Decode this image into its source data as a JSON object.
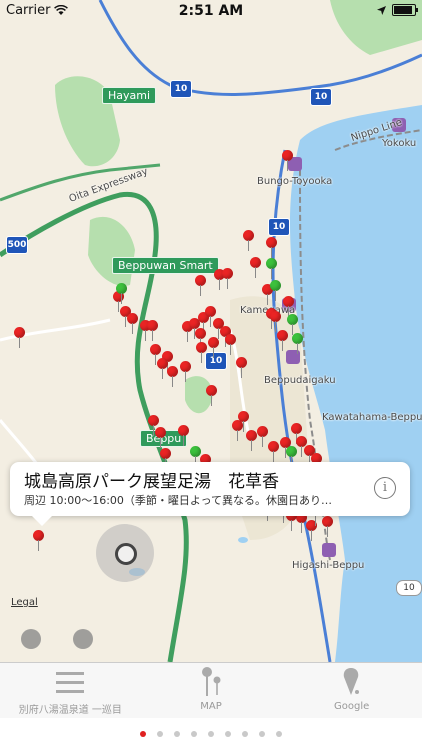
{
  "statusbar": {
    "carrier": "Carrier",
    "time": "2:51 AM",
    "battery_level": 0.95
  },
  "map": {
    "road_labels": [
      "Hayami",
      "Beppuwan Smart",
      "Beppu",
      "Oita Expressway",
      "Nippo Line"
    ],
    "place_labels": [
      "Yokoku",
      "Bungo-Toyooka",
      "Kamegawa",
      "Beppudaigaku",
      "Kawatahama-Beppu",
      "Higashi-Beppu"
    ],
    "highway_shields": [
      "10",
      "10",
      "10",
      "500",
      "10"
    ],
    "route_shield": "10",
    "legal": "Legal",
    "colors": {
      "land": "#f3eee2",
      "water": "#9fd0f2",
      "forest": "#8fcf8e",
      "expressway": "#3f9e5e",
      "red_pin": "#ea2424",
      "green_pin": "#3cc13c"
    }
  },
  "callout": {
    "title": "城島高原パーク展望足湯　花草香",
    "subtitle": "周辺 10:00～16:00（季節・曜日よって異なる。休園日あり…",
    "info_icon": "info-icon"
  },
  "controls": {
    "locate_icon": "location-icon"
  },
  "tabs": [
    {
      "label": "別府八湯温泉道 一巡目",
      "icon": "list-icon"
    },
    {
      "label": "MAP",
      "icon": "map-pins-icon"
    },
    {
      "label": "Google",
      "icon": "google-pin-icon"
    }
  ],
  "pager": {
    "count": 9,
    "active": 0
  }
}
